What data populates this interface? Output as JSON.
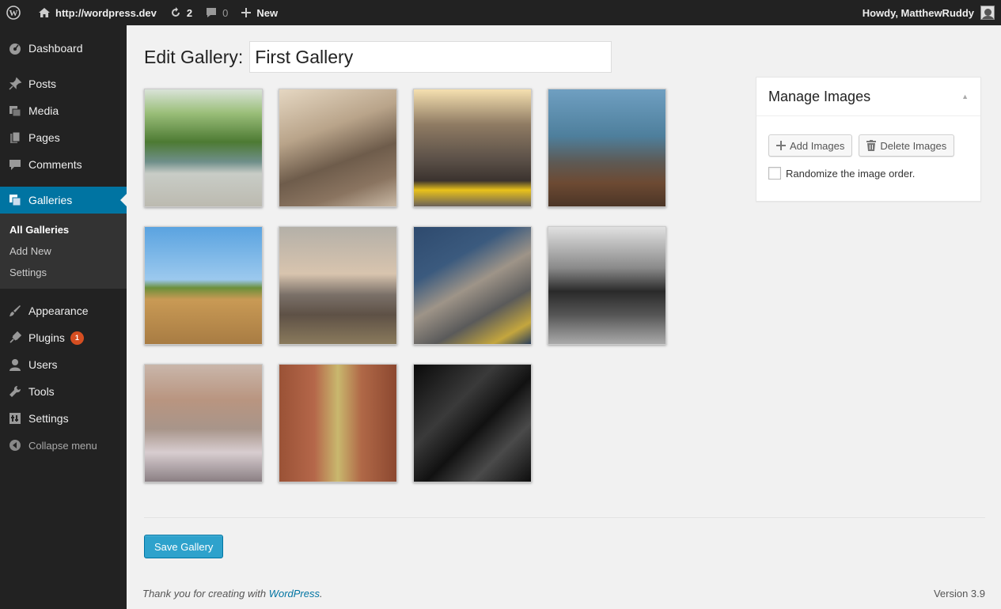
{
  "admin_bar": {
    "site_url": "http://wordpress.dev",
    "updates_count": "2",
    "comments_count": "0",
    "new_label": "New",
    "greeting": "Howdy, MatthewRuddy"
  },
  "sidebar": {
    "items": [
      {
        "label": "Dashboard",
        "icon": "dashboard-icon"
      },
      {
        "label": "Posts",
        "icon": "pin-icon"
      },
      {
        "label": "Media",
        "icon": "media-icon"
      },
      {
        "label": "Pages",
        "icon": "pages-icon"
      },
      {
        "label": "Comments",
        "icon": "comment-icon"
      },
      {
        "label": "Galleries",
        "icon": "gallery-icon"
      },
      {
        "label": "Appearance",
        "icon": "brush-icon"
      },
      {
        "label": "Plugins",
        "icon": "plugin-icon",
        "badge": "1"
      },
      {
        "label": "Users",
        "icon": "user-icon"
      },
      {
        "label": "Tools",
        "icon": "wrench-icon"
      },
      {
        "label": "Settings",
        "icon": "settings-icon"
      }
    ],
    "submenu": [
      "All Galleries",
      "Add New",
      "Settings"
    ],
    "collapse_label": "Collapse menu"
  },
  "page": {
    "title": "Edit Gallery:",
    "gallery_name": "First Gallery"
  },
  "gallery": {
    "images": [
      "thumbnail-1",
      "thumbnail-2",
      "thumbnail-3",
      "thumbnail-4",
      "thumbnail-5",
      "thumbnail-6",
      "thumbnail-7",
      "thumbnail-8",
      "thumbnail-9",
      "thumbnail-10",
      "thumbnail-11"
    ]
  },
  "manage_images": {
    "title": "Manage Images",
    "add_label": "Add Images",
    "delete_label": "Delete Images",
    "randomize_label": "Randomize the image order."
  },
  "save_label": "Save Gallery",
  "footer": {
    "thanks_prefix": "Thank you for creating with",
    "wordpress_link": "WordPress",
    "thanks_suffix": ".",
    "version": "Version 3.9"
  },
  "colors": {
    "admin_bar_bg": "#222222",
    "accent": "#0074a2",
    "button_primary": "#2ea2cc",
    "badge": "#d54e21"
  }
}
